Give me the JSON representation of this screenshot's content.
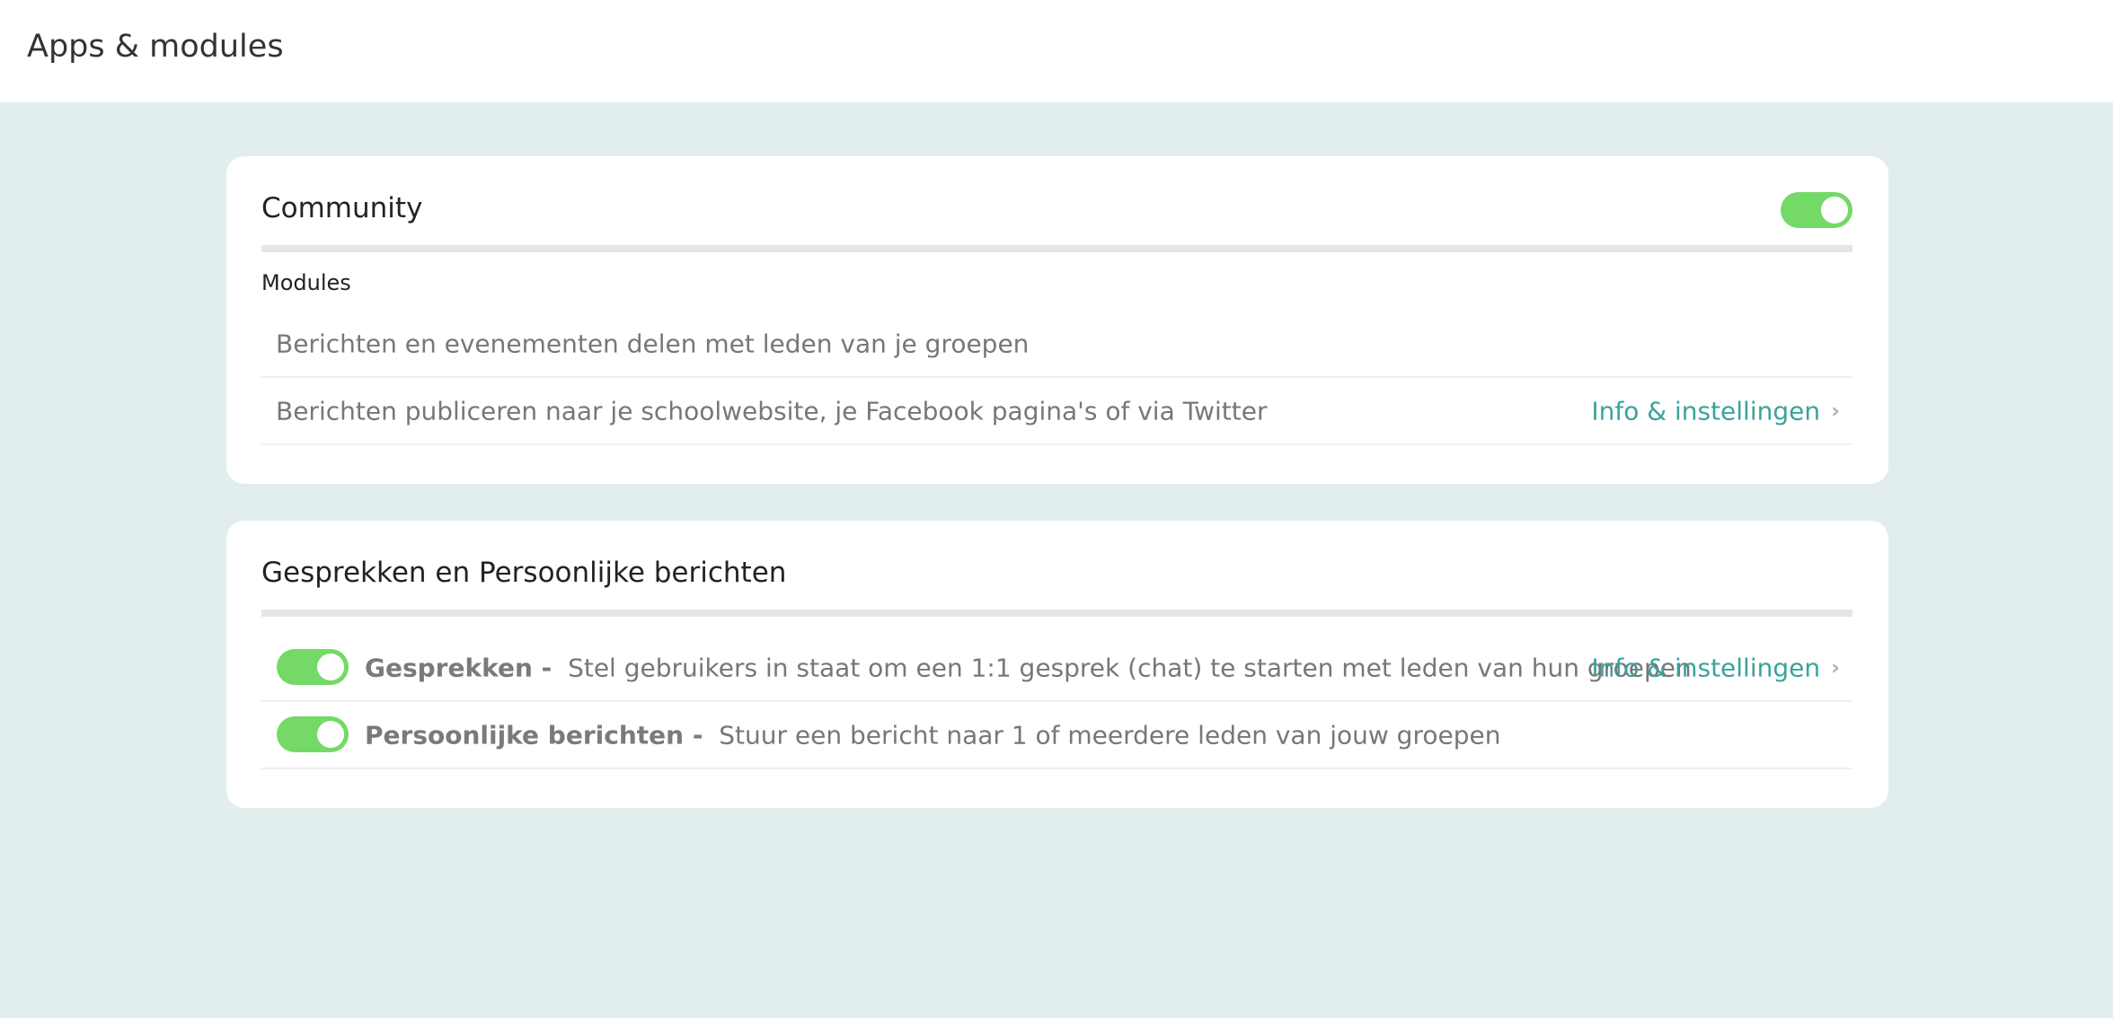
{
  "header": {
    "title": "Apps & modules"
  },
  "community": {
    "title": "Community",
    "toggle_on": true,
    "modules_label": "Modules",
    "rows": [
      {
        "text": "Berichten en evenementen delen met leden van je groepen"
      },
      {
        "text": "Berichten publiceren naar je schoolwebsite, je Facebook pagina's of via Twitter",
        "link": "Info & instellingen"
      }
    ]
  },
  "conversations": {
    "title": "Gesprekken en Persoonlijke berichten",
    "rows": [
      {
        "toggle_on": true,
        "name": "Gesprekken -",
        "text": "Stel gebruikers in staat om een 1:1 gesprek (chat) te starten met leden van hun groepen",
        "link": "Info & instellingen"
      },
      {
        "toggle_on": true,
        "name": "Persoonlijke berichten -",
        "text": "Stuur een bericht naar 1 of meerdere leden van jouw groepen"
      }
    ]
  },
  "colors": {
    "background": "#e2eeed",
    "toggle_on": "#74d966",
    "link": "#3aa39a"
  },
  "icons": {
    "chevron": "chevron-right-icon"
  }
}
